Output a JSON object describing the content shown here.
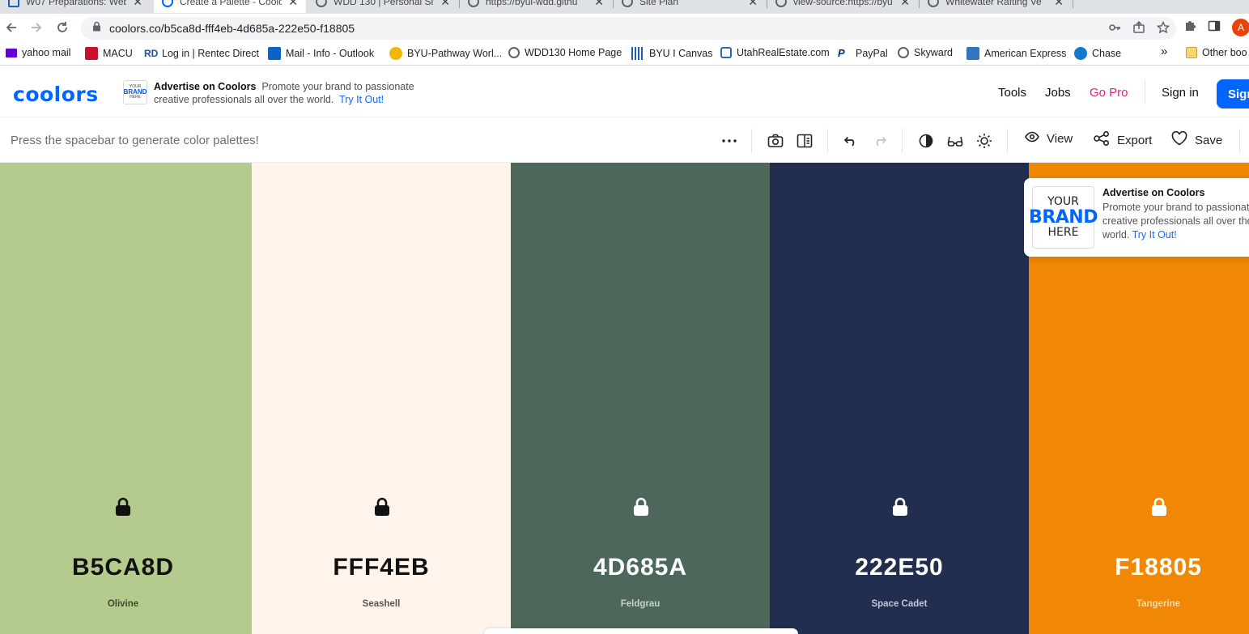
{
  "browser": {
    "tabs": [
      {
        "title": "W07 Preparations: Web",
        "active": false
      },
      {
        "title": "Create a Palette - Coolo",
        "active": true
      },
      {
        "title": "WDD 130 | Personal Sit",
        "active": false
      },
      {
        "title": "https://byui-wdd.githu",
        "active": false
      },
      {
        "title": "Site Plan",
        "active": false
      },
      {
        "title": "view-source:https://byu",
        "active": false
      },
      {
        "title": "Whitewater Rafting Ve",
        "active": false
      }
    ],
    "url": "coolors.co/b5ca8d-fff4eb-4d685a-222e50-f18805",
    "avatar_letter": "A",
    "bookmarks": [
      {
        "label": "yahoo mail",
        "icon": "yahoo-mail-icon",
        "color": "#6001d2"
      },
      {
        "label": "MACU",
        "icon": "macu-icon",
        "color": "#c8102e"
      },
      {
        "label": "Log in | Rentec Direct",
        "icon": "rentec-icon",
        "color": "#1d4ea1"
      },
      {
        "label": "Mail - Info - Outlook",
        "icon": "outlook-icon",
        "color": "#0a64c8"
      },
      {
        "label": "BYU-Pathway Worl...",
        "icon": "byu-pathway-icon",
        "color": "#f2b705"
      },
      {
        "label": "WDD130 Home Page",
        "icon": "globe-icon",
        "color": "#5f6368"
      },
      {
        "label": "BYU I Canvas",
        "icon": "canvas-icon",
        "color": "#1a5fb4"
      },
      {
        "label": "UtahRealEstate.com",
        "icon": "utah-realestate-icon",
        "color": "#2b6cb0"
      },
      {
        "label": "PayPal",
        "icon": "paypal-icon",
        "color": "#003087"
      },
      {
        "label": "Skyward",
        "icon": "globe-icon",
        "color": "#5f6368"
      },
      {
        "label": "American Express",
        "icon": "amex-icon",
        "color": "#2e77bc"
      },
      {
        "label": "Chase",
        "icon": "chase-icon",
        "color": "#117aca"
      }
    ],
    "bookmarks_overflow": "»",
    "other_bookmarks": "Other boo"
  },
  "site": {
    "logo": "coolors",
    "ad": {
      "thumb_lines": [
        "YOUR",
        "BRAND",
        "HERE"
      ],
      "title": "Advertise on Coolors",
      "text": "Promote your brand to passionate creative professionals all over the world.",
      "cta": "Try It Out!"
    },
    "nav": {
      "tools": "Tools",
      "jobs": "Jobs",
      "go_pro": "Go Pro",
      "sign_in": "Sign in",
      "sign_up": "Sign"
    }
  },
  "generator": {
    "hint": "Press the spacebar to generate color palettes!",
    "view_label": "View",
    "export_label": "Export",
    "save_label": "Save"
  },
  "palette": [
    {
      "hex": "B5CA8D",
      "name": "Olivine",
      "bg": "#b5ca8d",
      "fg": "#111111",
      "sub": "#3d4a2b"
    },
    {
      "hex": "FFF4EB",
      "name": "Seashell",
      "bg": "#fff4eb",
      "fg": "#111111",
      "sub": "#5a5450"
    },
    {
      "hex": "4D685A",
      "name": "Feldgrau",
      "bg": "#4d685a",
      "fg": "#ffffff",
      "sub": "#c6d2cb"
    },
    {
      "hex": "222E50",
      "name": "Space Cadet",
      "bg": "#222e50",
      "fg": "#ffffff",
      "sub": "#c3c8d6"
    },
    {
      "hex": "F18805",
      "name": "Tangerine",
      "bg": "#f18805",
      "fg": "#ffffff",
      "sub": "#fbd9ad"
    }
  ],
  "side_ad": {
    "brand_lines": [
      "YOUR",
      "BRAND",
      "HERE"
    ],
    "title": "Advertise on Coolors",
    "text": "Promote your brand to passionate creative professionals all over the world.",
    "cta": "Try It Out!"
  }
}
